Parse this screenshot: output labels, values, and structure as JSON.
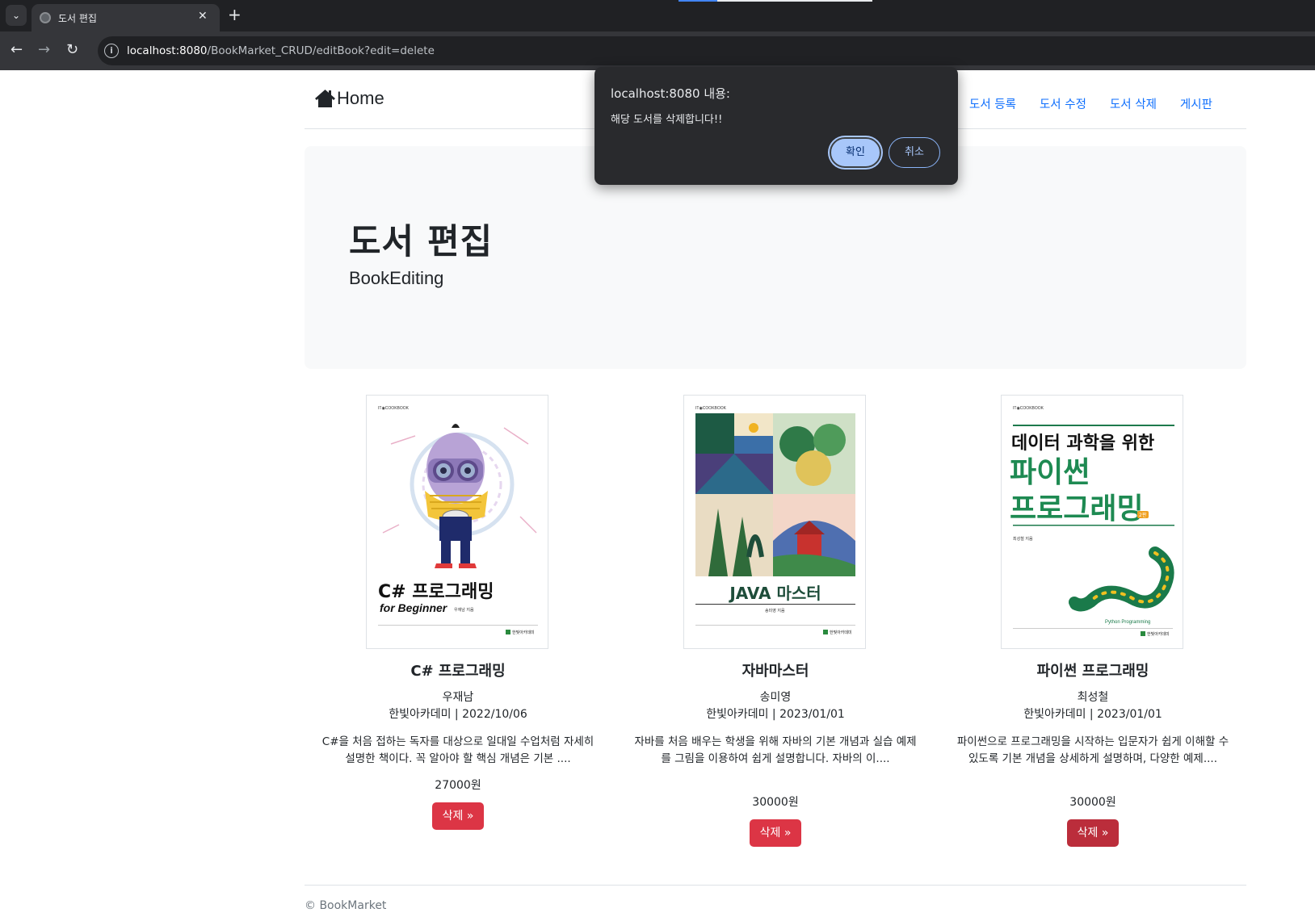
{
  "browser": {
    "tab_title": "도서 편집",
    "new_tab_symbol": "+",
    "close_symbol": "✕",
    "url_host": "localhost:8080",
    "url_path": "/BookMarket_CRUD/editBook?edit=delete"
  },
  "header": {
    "brand": "Home",
    "nav": [
      "도서 등록",
      "도서 수정",
      "도서 삭제",
      "게시판"
    ]
  },
  "jumbotron": {
    "title": "도서 편집",
    "subtitle": "BookEditing"
  },
  "books": [
    {
      "title": "C# 프로그래밍",
      "author": "우재남",
      "publisher_date": "한빛아카데미 | 2022/10/06",
      "description": "C#을 처음 접하는 독자를 대상으로 일대일 수업처럼 자세히 설명한 책이다. 꼭 알아야 할 핵심 개념은 기본 ....",
      "price": "27000원",
      "button": "삭제 »",
      "cover": {
        "series": "IT◉COOKBOOK",
        "title_line1": "C# 프로그래밍",
        "title_line2": "for Beginner",
        "author_note": "우재남 지음",
        "publisher_logo": "한빛아카데미"
      }
    },
    {
      "title": "자바마스터",
      "author": "송미영",
      "publisher_date": "한빛아카데미 | 2023/01/01",
      "description": "자바를 처음 배우는 학생을 위해 자바의 기본 개념과 실습 예제를 그림을 이용하여 쉽게 설명합니다. 자바의 이....",
      "price": "30000원",
      "button": "삭제 »",
      "cover": {
        "series": "IT◉COOKBOOK",
        "title_line1": "JAVA 마스터",
        "author_note": "송미영 지음",
        "publisher_logo": "한빛아카데미"
      }
    },
    {
      "title": "파이썬 프로그래밍",
      "author": "최성철",
      "publisher_date": "한빛아카데미 | 2023/01/01",
      "description": "파이썬으로 프로그래밍을 시작하는 입문자가 쉽게 이해할 수 있도록 기본 개념을 상세하게 설명하며, 다양한 예제....",
      "price": "30000원",
      "button": "삭제 »",
      "cover": {
        "series": "IT◉COOKBOOK",
        "title_line1": "데이터 과학을 위한",
        "title_line2": "파이썬",
        "title_line3": "프로그래밍",
        "edition": "2판",
        "author_note": "최성철 지음",
        "tag": "Python Programming",
        "publisher_logo": "한빛아카데미"
      }
    }
  ],
  "footer": {
    "text": "© BookMarket"
  },
  "dialog": {
    "title": "localhost:8080 내용:",
    "message": "해당 도서를 삭제합니다!!",
    "ok_label": "확인",
    "cancel_label": "취소"
  },
  "colors": {
    "link": "#0d6efd",
    "danger": "#dc3545",
    "danger_hover": "#bb2d3b",
    "dialog_bg": "#292a2d",
    "dialog_primary": "#a8c7fa"
  }
}
